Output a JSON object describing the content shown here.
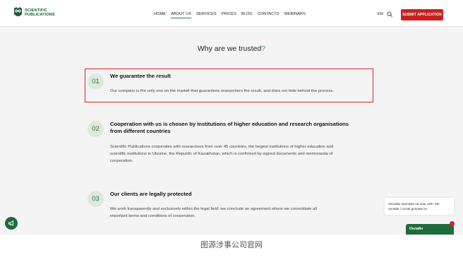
{
  "header": {
    "logo_line1": "SCIENTIFIC",
    "logo_line2": "PUBLICATIONS",
    "nav": [
      "HOME",
      "ABOUT US",
      "SERVICES",
      "PRICES",
      "BLOG",
      "CONTACTS",
      "WEBINARS"
    ],
    "active_nav": "ABOUT US",
    "lang": "EN",
    "submit_label": "SUBMIT APPLICATION",
    "accent_color": "#c9201f",
    "brand_color": "#1e5b3a"
  },
  "section": {
    "title": "Why are we trusted",
    "title_mark": "?"
  },
  "items": [
    {
      "number": "01",
      "title": "We guarantee the result",
      "text": [
        "Our company is the only one on the market that guarantees researchers the result, and does not hide behind the process."
      ]
    },
    {
      "number": "02",
      "title_lines": [
        "Cooperation with us is chosen by institutions of higher education and research organisations",
        "from different countries"
      ],
      "text": [
        "Scientific Publications cooperates with researchers from over 45 countries, the largest institutions of higher education and",
        "scientific institutions in Ukraine, the Republic of Kazakhstan, which is confirmed by signed documents and memoranda of",
        "cooperation."
      ]
    },
    {
      "number": "03",
      "title": "Our clients are legally protected",
      "text": [
        "We work transparently and exclusively within the legal field; we conclude an agreement where we consolidate all",
        "important terms and conditions of cooperation."
      ]
    }
  ],
  "chat": {
    "bubble_line1": "Ласкаво просимо на наш сайт. Ми",
    "bubble_line2": "онлайн і готові допомогти.",
    "tab_label": "Онлайн"
  },
  "caption": "图源涉事公司官网"
}
